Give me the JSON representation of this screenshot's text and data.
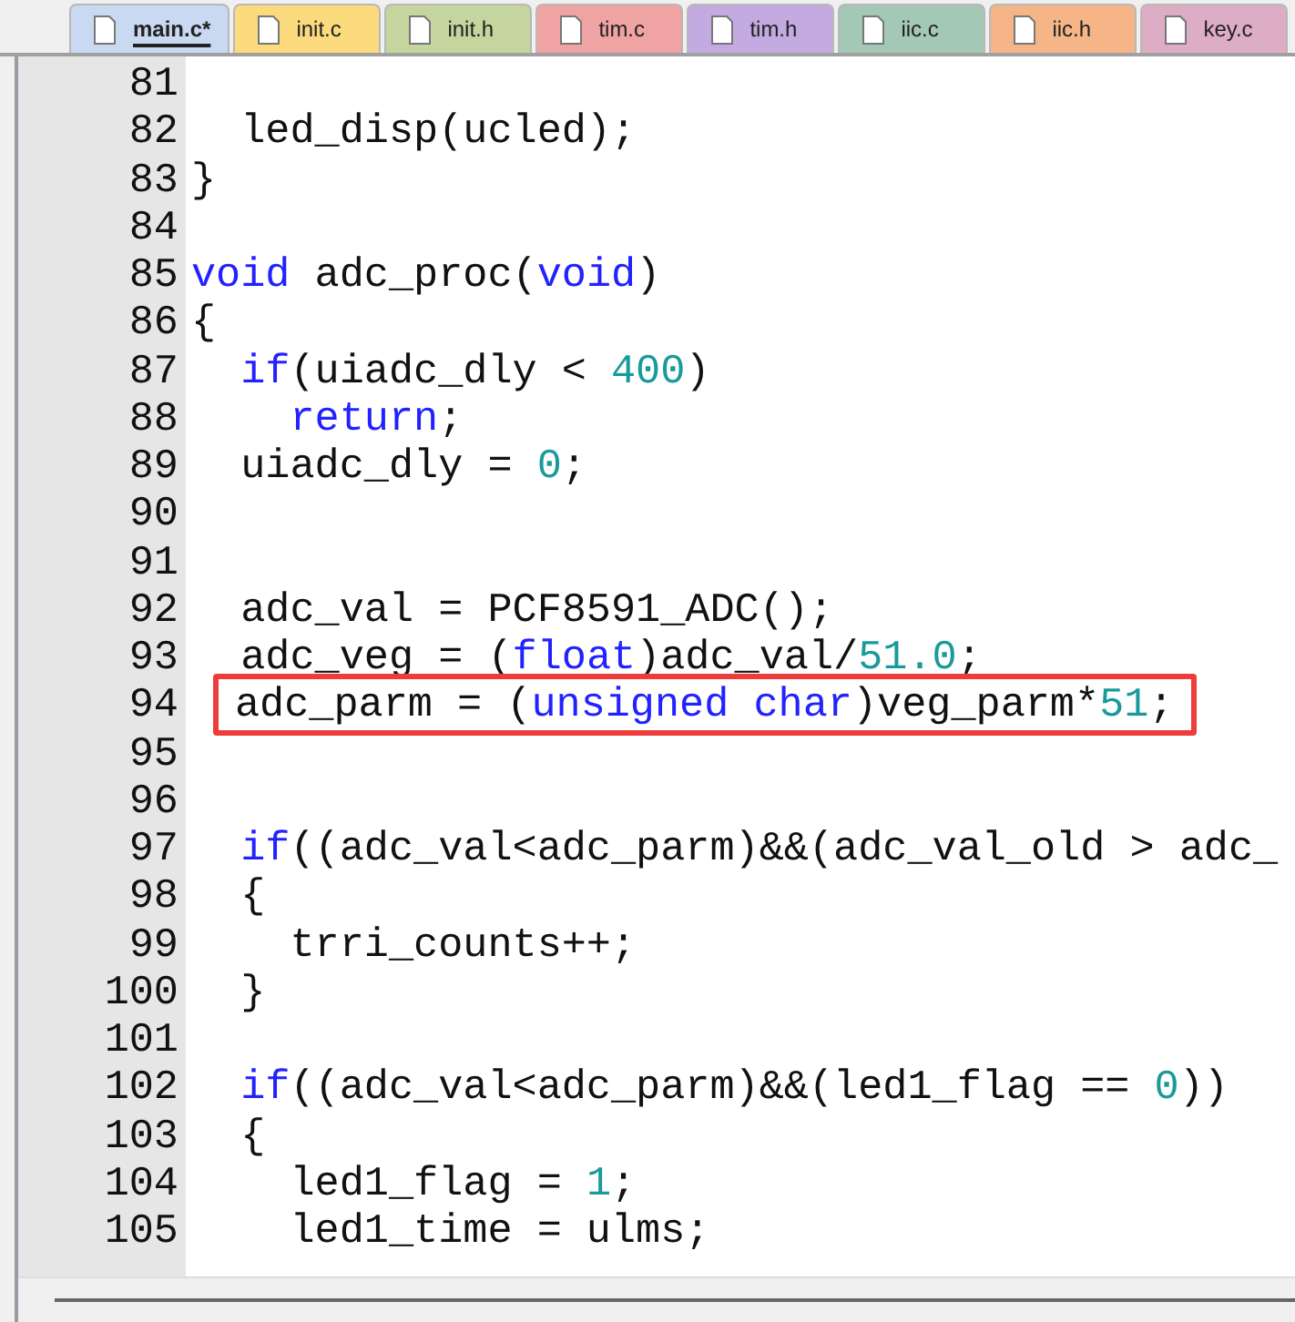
{
  "tabs": [
    {
      "label": "main.c*",
      "color": "#c9d9f1",
      "selected": true
    },
    {
      "label": "init.c",
      "color": "#fbdb7d",
      "selected": false
    },
    {
      "label": "init.h",
      "color": "#c5d59e",
      "selected": false
    },
    {
      "label": "tim.c",
      "color": "#f0a3a3",
      "selected": false
    },
    {
      "label": "tim.h",
      "color": "#c3abe1",
      "selected": false
    },
    {
      "label": "iic.c",
      "color": "#a3c9b6",
      "selected": false
    },
    {
      "label": "iic.h",
      "color": "#f5b586",
      "selected": false
    },
    {
      "label": "key.c",
      "color": "#ddadc6",
      "selected": false
    }
  ],
  "editor": {
    "lines": [
      {
        "number": "81"
      },
      {
        "number": "82",
        "code": [
          {
            "kind": "plain",
            "text": "  led_disp(ucled);"
          }
        ]
      },
      {
        "number": "83",
        "code": [
          {
            "kind": "plain",
            "text": "}"
          }
        ]
      },
      {
        "number": "84"
      },
      {
        "number": "85",
        "code": [
          {
            "kind": "keyword",
            "text": "void"
          },
          {
            "kind": "plain",
            "text": " adc_proc("
          },
          {
            "kind": "keyword",
            "text": "void"
          },
          {
            "kind": "plain",
            "text": ")"
          }
        ]
      },
      {
        "number": "86",
        "code": [
          {
            "kind": "plain",
            "text": "{"
          }
        ]
      },
      {
        "number": "87",
        "code": [
          {
            "kind": "keyword",
            "text": "  if"
          },
          {
            "kind": "plain",
            "text": "(uiadc_dly < "
          },
          {
            "kind": "number",
            "text": "400"
          },
          {
            "kind": "plain",
            "text": ")"
          }
        ]
      },
      {
        "number": "88",
        "code": [
          {
            "kind": "keyword",
            "text": "    return"
          },
          {
            "kind": "plain",
            "text": ";"
          }
        ]
      },
      {
        "number": "89",
        "code": [
          {
            "kind": "plain",
            "text": "  uiadc_dly = "
          },
          {
            "kind": "number",
            "text": "0"
          },
          {
            "kind": "plain",
            "text": ";"
          }
        ]
      },
      {
        "number": "90"
      },
      {
        "number": "91"
      },
      {
        "number": "92",
        "code": [
          {
            "kind": "plain",
            "text": "  adc_val = PCF8591_ADC();"
          }
        ]
      },
      {
        "number": "93",
        "code": [
          {
            "kind": "plain",
            "text": "  adc_veg = ("
          },
          {
            "kind": "keyword",
            "text": "float"
          },
          {
            "kind": "plain",
            "text": ")adc_val/"
          },
          {
            "kind": "number",
            "text": "51.0"
          },
          {
            "kind": "plain",
            "text": ";"
          }
        ]
      },
      {
        "number": "94",
        "highlighted": true,
        "code": [
          {
            "kind": "plain",
            "text": "adc_parm = ("
          },
          {
            "kind": "keyword",
            "text": "unsigned char"
          },
          {
            "kind": "plain",
            "text": ")veg_parm*"
          },
          {
            "kind": "number",
            "text": "51"
          },
          {
            "kind": "plain",
            "text": ";"
          }
        ]
      },
      {
        "number": "95"
      },
      {
        "number": "96"
      },
      {
        "number": "97",
        "code": [
          {
            "kind": "keyword",
            "text": "  if"
          },
          {
            "kind": "plain",
            "text": "((adc_val<adc_parm)&&(adc_val_old > adc_"
          }
        ]
      },
      {
        "number": "98",
        "code": [
          {
            "kind": "plain",
            "text": "  {"
          }
        ]
      },
      {
        "number": "99",
        "code": [
          {
            "kind": "plain",
            "text": "    trri_counts++;"
          }
        ]
      },
      {
        "number": "100",
        "code": [
          {
            "kind": "plain",
            "text": "  }"
          }
        ]
      },
      {
        "number": "101"
      },
      {
        "number": "102",
        "code": [
          {
            "kind": "keyword",
            "text": "  if"
          },
          {
            "kind": "plain",
            "text": "((adc_val<adc_parm)&&(led1_flag == "
          },
          {
            "kind": "number",
            "text": "0"
          },
          {
            "kind": "plain",
            "text": "))"
          }
        ]
      },
      {
        "number": "103",
        "code": [
          {
            "kind": "plain",
            "text": "  {"
          }
        ]
      },
      {
        "number": "104",
        "code": [
          {
            "kind": "plain",
            "text": "    led1_flag = "
          },
          {
            "kind": "number",
            "text": "1"
          },
          {
            "kind": "plain",
            "text": ";"
          }
        ]
      },
      {
        "number": "105",
        "code": [
          {
            "kind": "plain",
            "text": "    led1_time = ulms;"
          }
        ]
      }
    ]
  }
}
